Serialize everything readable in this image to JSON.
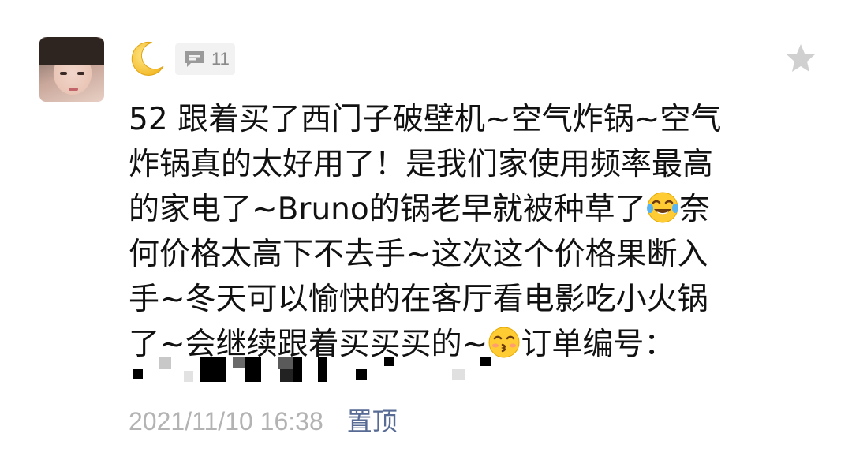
{
  "post": {
    "comment_count": "11",
    "text_lines": [
      "52 跟着买了西门子破壁机~空气炸锅~空气",
      "炸锅真的太好用了！是我们家使用频率最高",
      "的家电了~Bruno的锅老早就被种草了",
      "奈",
      "何价格太高下不去手~这次这个价格果断入",
      "手~冬天可以愉快的在客厅看电影吃小火锅",
      "了~会继续跟着买买买的~",
      "订单编号："
    ],
    "timestamp": "2021/11/10 16:38",
    "pin_label": "置顶"
  },
  "icons": {
    "nickname": "crescent-moon-emoji",
    "comment": "comment-bubble-icon",
    "favorite": "star-icon",
    "emoji_1": "tears-of-joy-emoji",
    "emoji_2": "kissing-face-emoji"
  },
  "colors": {
    "text": "#111111",
    "timestamp": "#b3b3b3",
    "link": "#576b95",
    "chip_bg": "#f2f2f2",
    "star": "#d0d0d0"
  }
}
